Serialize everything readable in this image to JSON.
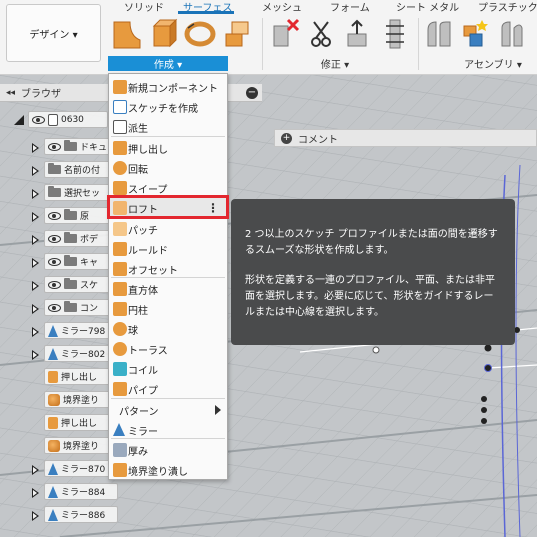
{
  "ribbon": {
    "design_button": "デザイン ▾",
    "tabs": {
      "solid": "ソリッド",
      "surface": "サーフェス",
      "mesh": "メッシュ",
      "form": "フォーム",
      "sheet_metal": "シート メタル",
      "plastic": "プラスチック"
    },
    "groups": {
      "create": "作成 ▾",
      "modify": "修正 ▾",
      "assemble": "アセンブリ ▾"
    }
  },
  "browser": {
    "title": "ブラウザ",
    "collapse_icon": "−",
    "root_label": "0630",
    "rows": [
      {
        "label": "ドキュメント"
      },
      {
        "label": "名前の付"
      },
      {
        "label": "選択セッ"
      },
      {
        "label": "原"
      },
      {
        "label": "ボデ"
      },
      {
        "label": "キャ"
      },
      {
        "label": "スケ"
      },
      {
        "label": "コン"
      },
      {
        "label": "ミラー798"
      },
      {
        "label": "ミラー802"
      },
      {
        "label": "押し出し"
      },
      {
        "label": "境界塗り"
      },
      {
        "label": "押し出し"
      },
      {
        "label": "境界塗り"
      },
      {
        "label": "ミラー870"
      },
      {
        "label": "ミラー884"
      },
      {
        "label": "ミラー886"
      }
    ]
  },
  "create_menu": {
    "items": [
      {
        "label": "新規コンポーネント",
        "icon": "new-component-icon"
      },
      {
        "label": "スケッチを作成",
        "icon": "create-sketch-icon"
      },
      {
        "label": "派生",
        "icon": "derive-icon"
      },
      {
        "label": "押し出し",
        "icon": "extrude-icon"
      },
      {
        "label": "回転",
        "icon": "revolve-icon"
      },
      {
        "label": "スイープ",
        "icon": "sweep-icon"
      },
      {
        "label": "ロフト",
        "icon": "loft-icon"
      },
      {
        "label": "パッチ",
        "icon": "patch-icon"
      },
      {
        "label": "ルールド",
        "icon": "ruled-icon"
      },
      {
        "label": "オフセット",
        "icon": "offset-icon"
      },
      {
        "label": "直方体",
        "icon": "box-icon"
      },
      {
        "label": "円柱",
        "icon": "cylinder-icon"
      },
      {
        "label": "球",
        "icon": "sphere-icon"
      },
      {
        "label": "トーラス",
        "icon": "torus-icon"
      },
      {
        "label": "コイル",
        "icon": "coil-icon"
      },
      {
        "label": "パイプ",
        "icon": "pipe-icon"
      },
      {
        "label": "パターン",
        "icon": "pattern-submenu-arrow"
      },
      {
        "label": "ミラー",
        "icon": "mirror-icon"
      },
      {
        "label": "厚み",
        "icon": "thicken-icon"
      },
      {
        "label": "境界塗り潰し",
        "icon": "boundary-fill-icon"
      }
    ],
    "more_icon": "⋮"
  },
  "comment_bar": {
    "label": "コメント",
    "icon": "+"
  },
  "tooltip": {
    "paragraph1": "2 つ以上のスケッチ プロファイルまたは面の間を遷移するスムーズな形状を作成します。",
    "paragraph2": "形状を定義する一連のプロファイル、平面、または非平面を選択します。必要に応じて、形状をガイドするレールまたは中心線を選択します。"
  },
  "colors": {
    "accent": "#1a8fd6",
    "highlight_border": "#e3272f",
    "tooltip_bg": "#4a4b4c",
    "surface_orange": "#e79a3e"
  }
}
